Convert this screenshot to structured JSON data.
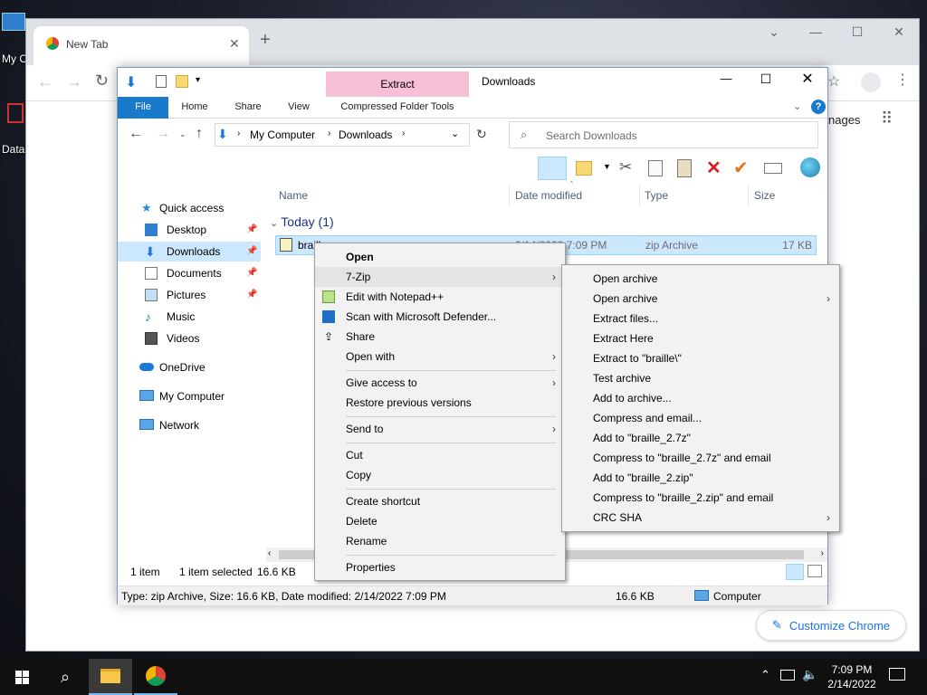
{
  "desktop": {
    "icon1_label": "My C",
    "icon2_label": "Data"
  },
  "chrome": {
    "tab_title": "New Tab",
    "images_link": "nages",
    "customize_label": "Customize Chrome"
  },
  "explorer": {
    "title": "Downloads",
    "contextual_tab": "Extract",
    "tabs": [
      "File",
      "Home",
      "Share",
      "View",
      "Compressed Folder Tools"
    ],
    "breadcrumb": [
      "My Computer",
      "Downloads"
    ],
    "search_placeholder": "Search Downloads",
    "nav": {
      "quick_access": "Quick access",
      "desktop": "Desktop",
      "downloads": "Downloads",
      "documents": "Documents",
      "pictures": "Pictures",
      "music": "Music",
      "videos": "Videos",
      "onedrive": "OneDrive",
      "my_computer": "My Computer",
      "network": "Network"
    },
    "columns": {
      "name": "Name",
      "date": "Date modified",
      "type": "Type",
      "size": "Size"
    },
    "group_header": "Today (1)",
    "file": {
      "name": "braill",
      "date": "2/14/2022 7:09 PM",
      "type": "zip Archive",
      "size": "17 KB"
    },
    "status": {
      "items": "1 item",
      "selected": "1 item selected",
      "sel_size": "16.6 KB"
    },
    "details_bar": {
      "text": "Type: zip Archive, Size: 16.6 KB, Date modified: 2/14/2022 7:09 PM",
      "size": "16.6 KB",
      "location": "Computer"
    }
  },
  "context_menu": {
    "open": "Open",
    "sevenzip": "7-Zip",
    "notepad": "Edit with Notepad++",
    "defender": "Scan with Microsoft Defender...",
    "share": "Share",
    "open_with": "Open with",
    "give_access": "Give access to",
    "restore": "Restore previous versions",
    "send_to": "Send to",
    "cut": "Cut",
    "copy": "Copy",
    "create_shortcut": "Create shortcut",
    "delete": "Delete",
    "rename": "Rename",
    "properties": "Properties"
  },
  "sevenzip_menu": [
    "Open archive",
    "Open archive",
    "Extract files...",
    "Extract Here",
    "Extract to \"braille\\\"",
    "Test archive",
    "Add to archive...",
    "Compress and email...",
    "Add to \"braille_2.7z\"",
    "Compress to \"braille_2.7z\" and email",
    "Add to \"braille_2.zip\"",
    "Compress to \"braille_2.zip\" and email",
    "CRC SHA"
  ],
  "taskbar": {
    "time": "7:09 PM",
    "date": "2/14/2022"
  }
}
